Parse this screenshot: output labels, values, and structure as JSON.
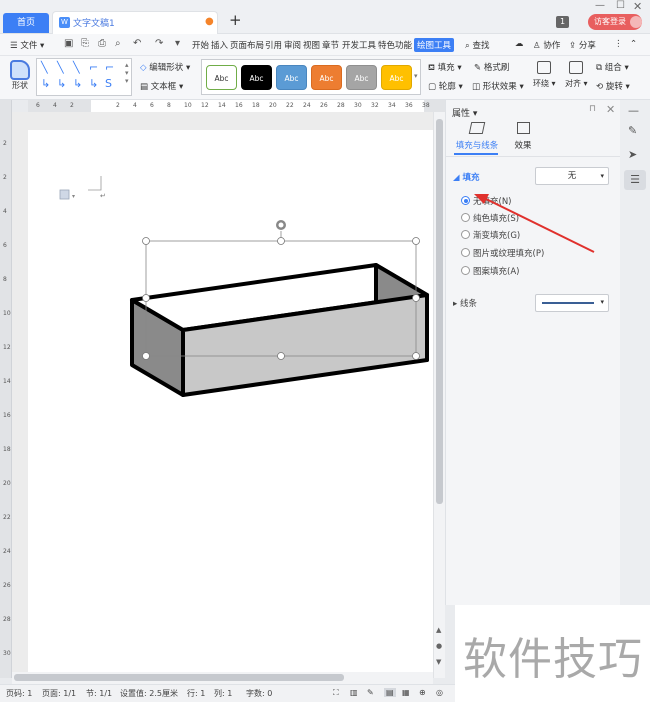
{
  "titlebar": {
    "home_tab": "首页",
    "doc_tab": "文字文稿1",
    "doc_icon": "W",
    "page_badge": "1",
    "login": "访客登录"
  },
  "menu": {
    "file": "文件",
    "items": [
      "开始",
      "插入",
      "页面布局",
      "引用",
      "审阅",
      "视图",
      "章节",
      "开发工具",
      "特色功能",
      "绘图工具"
    ],
    "search": "查找",
    "collab": "协作",
    "share": "分享"
  },
  "ribbon": {
    "shape": "形状",
    "edit_shape": "编辑形状",
    "textbox": "文本框",
    "styles": [
      {
        "label": "Abc",
        "bg": "#ffffff",
        "fg": "#333333",
        "border": "#70ad47"
      },
      {
        "label": "Abc",
        "bg": "#000000",
        "fg": "#ffffff",
        "border": "#000000"
      },
      {
        "label": "Abc",
        "bg": "#5b9bd5",
        "fg": "#ffffff",
        "border": "#4a86be"
      },
      {
        "label": "Abc",
        "bg": "#ed7d31",
        "fg": "#ffffff",
        "border": "#d96b20"
      },
      {
        "label": "Abc",
        "bg": "#a5a5a5",
        "fg": "#ffffff",
        "border": "#8f8f8f"
      },
      {
        "label": "Abc",
        "bg": "#ffc000",
        "fg": "#ffffff",
        "border": "#e0a800"
      }
    ],
    "fill": "填充",
    "format_painter": "格式刷",
    "outline": "轮廓",
    "shape_effect": "形状效果",
    "wrap": "环绕",
    "align": "对齐",
    "group": "组合",
    "rotate": "旋转"
  },
  "rulers": {
    "h": [
      "6",
      "4",
      "2",
      "2",
      "4",
      "6",
      "8",
      "10",
      "12",
      "14",
      "16",
      "18",
      "20",
      "22",
      "24",
      "26",
      "28",
      "30",
      "32",
      "34",
      "36",
      "38"
    ],
    "v": [
      "2",
      "2",
      "4",
      "6",
      "8",
      "10",
      "12",
      "14",
      "16",
      "18",
      "20",
      "22",
      "24",
      "26",
      "28",
      "30"
    ]
  },
  "panel": {
    "title": "属性",
    "tab_fill": "填充与线条",
    "tab_effect": "效果",
    "fill_label": "填充",
    "fill_value": "无",
    "options": [
      "无填充(N)",
      "纯色填充(S)",
      "渐变填充(G)",
      "图片或纹理填充(P)",
      "图案填充(A)"
    ],
    "line_label": "线条"
  },
  "status": {
    "page": "页码: 1",
    "pages": "页面: 1/1",
    "section": "节: 1/1",
    "setting": "设置值: 2.5厘米",
    "row": "行: 1",
    "col": "列: 1",
    "words": "字数: 0"
  },
  "watermark": "软件技巧",
  "colors": {
    "accent": "#3c7ff5",
    "login": "#e85f5f",
    "arrow": "#e0312d"
  }
}
